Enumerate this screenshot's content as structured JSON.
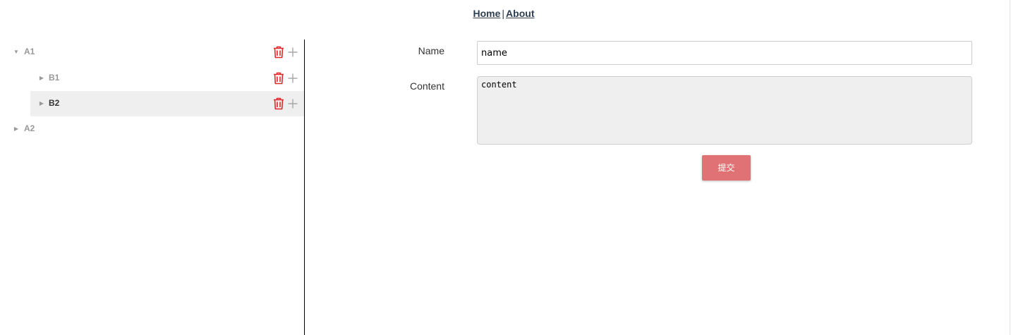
{
  "nav": {
    "home_label": "Home",
    "separator": "|",
    "about_label": "About"
  },
  "tree": {
    "nodes": [
      {
        "label": "A1",
        "expanded": true,
        "arrow": "▼",
        "selected": false
      },
      {
        "label": "B1",
        "expanded": false,
        "arrow": "▶",
        "selected": false
      },
      {
        "label": "B2",
        "expanded": false,
        "arrow": "▶",
        "selected": true
      },
      {
        "label": "A2",
        "expanded": false,
        "arrow": "▶",
        "selected": false
      }
    ],
    "delete_icon": "trash-icon",
    "add_icon": "plus-icon"
  },
  "form": {
    "name_label": "Name",
    "name_value": "name",
    "content_label": "Content",
    "content_value": "content",
    "submit_label": "提交"
  },
  "colors": {
    "accent": "#e07275",
    "delete": "#e0272b",
    "selected_bg": "#efefef"
  }
}
